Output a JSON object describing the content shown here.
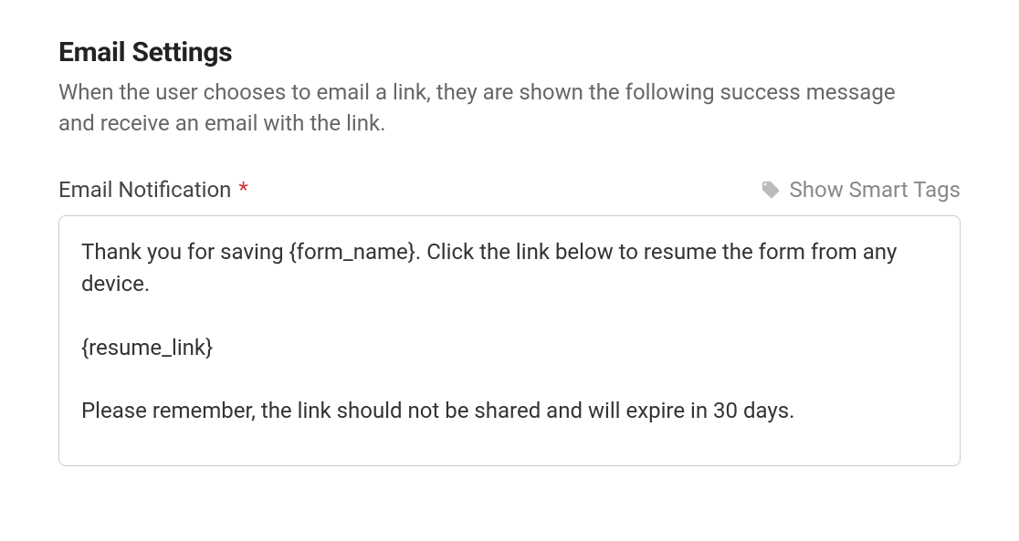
{
  "heading": "Email Settings",
  "description": "When the user chooses to email a link, they are shown the following success message and receive an email with the link.",
  "field": {
    "label": "Email Notification",
    "required_marker": "*",
    "smart_tags_label": "Show Smart Tags",
    "value": "Thank you for saving {form_name}. Click the link below to resume the form from any device.\n\n{resume_link}\n\nPlease remember, the link should not be shared and will expire in 30 days."
  }
}
